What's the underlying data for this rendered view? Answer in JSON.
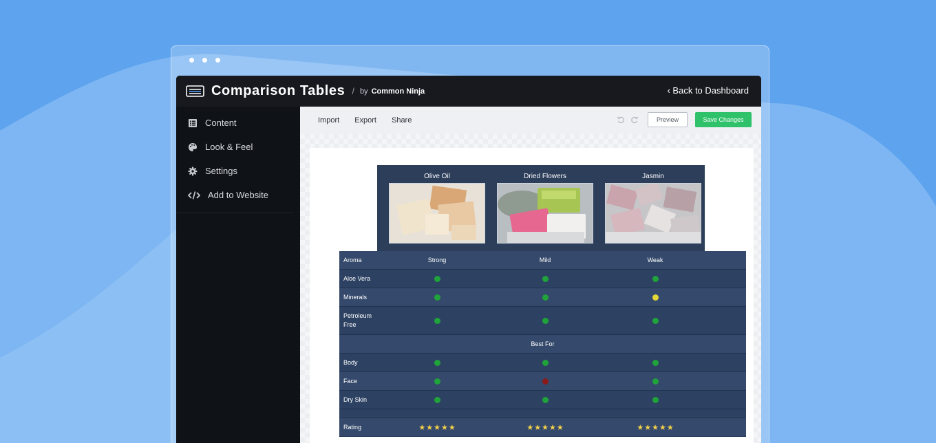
{
  "app": {
    "title": "Comparison Tables",
    "separator": "/",
    "by_label": "by",
    "brand": "Common Ninja",
    "back_link": "‹ Back to Dashboard"
  },
  "sidebar": {
    "items": [
      {
        "label": "Content",
        "icon": "list-icon"
      },
      {
        "label": "Look & Feel",
        "icon": "palette-icon"
      },
      {
        "label": "Settings",
        "icon": "gear-icon"
      },
      {
        "label": "Add to Website",
        "icon": "code-icon"
      }
    ]
  },
  "toolbar": {
    "import_label": "Import",
    "export_label": "Export",
    "share_label": "Share",
    "preview_label": "Preview",
    "save_label": "Save Changes"
  },
  "colors": {
    "accent_green": "#2fc26a",
    "table_bg": "#2d4262",
    "dot_green": "#1fa33a",
    "dot_yellow": "#e3d638",
    "dot_red": "#8a1b1b"
  },
  "table": {
    "products": [
      "Olive Oil",
      "Dried Flowers",
      "Jasmin"
    ],
    "aroma": {
      "label": "Aroma",
      "values": [
        "Strong",
        "Mild",
        "Weak"
      ]
    },
    "rows_a": [
      {
        "label": "Aloe Vera",
        "dots": [
          "green",
          "green",
          "green"
        ]
      },
      {
        "label": "Minerals",
        "dots": [
          "green",
          "green",
          "yellow"
        ]
      },
      {
        "label": "Petroleum Free",
        "dots": [
          "green",
          "green",
          "green"
        ]
      }
    ],
    "section_label": "Best For",
    "rows_b": [
      {
        "label": "Body",
        "dots": [
          "green",
          "green",
          "green"
        ]
      },
      {
        "label": "Face",
        "dots": [
          "green",
          "red",
          "green"
        ]
      },
      {
        "label": "Dry Skin",
        "dots": [
          "green",
          "green",
          "green"
        ]
      }
    ],
    "rating": {
      "label": "Rating",
      "stars": [
        5,
        5,
        5
      ],
      "max": 5
    }
  }
}
